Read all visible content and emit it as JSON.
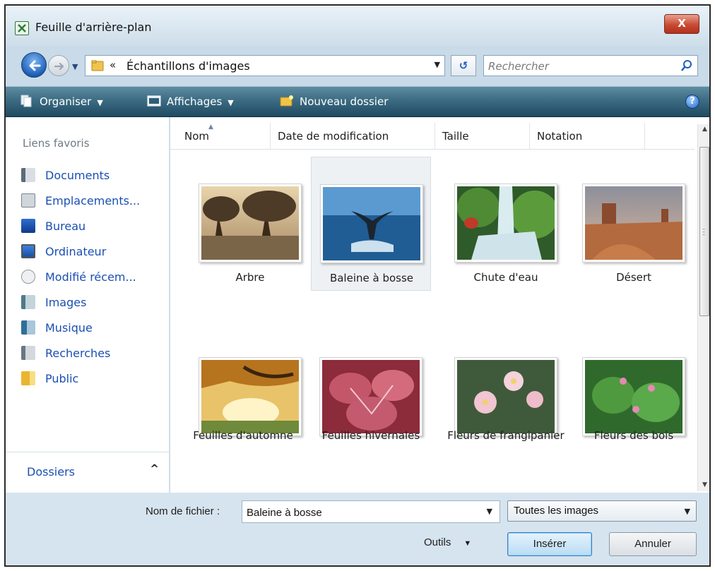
{
  "window": {
    "title": "Feuille d'arrière-plan",
    "close_label": "X"
  },
  "address": {
    "separator": "«",
    "path": "Échantillons d'images",
    "search_placeholder": "Rechercher",
    "refresh_label": "↺"
  },
  "toolbar": {
    "organize": "Organiser",
    "views": "Affichages",
    "new_folder": "Nouveau dossier",
    "help": "?"
  },
  "nav": {
    "title": "Liens favoris",
    "items": [
      {
        "label": "Documents",
        "icon": "documents-icon"
      },
      {
        "label": "Emplacements...",
        "icon": "network-places-icon"
      },
      {
        "label": "Bureau",
        "icon": "desktop-icon"
      },
      {
        "label": "Ordinateur",
        "icon": "computer-icon"
      },
      {
        "label": "Modifié récem...",
        "icon": "recent-icon"
      },
      {
        "label": "Images",
        "icon": "pictures-icon"
      },
      {
        "label": "Musique",
        "icon": "music-icon"
      },
      {
        "label": "Recherches",
        "icon": "searches-icon"
      },
      {
        "label": "Public",
        "icon": "public-folder-icon"
      }
    ],
    "folders_label": "Dossiers",
    "folders_toggle": "^"
  },
  "columns": [
    "Nom",
    "Date de modification",
    "Taille",
    "Notation"
  ],
  "files": [
    {
      "label": "Arbre",
      "selected": false
    },
    {
      "label": "Baleine à bosse",
      "selected": true
    },
    {
      "label": "Chute d'eau",
      "selected": false
    },
    {
      "label": "Désert",
      "selected": false
    },
    {
      "label": "Feuilles d'automne",
      "selected": false
    },
    {
      "label": "Feuilles hivernales",
      "selected": false
    },
    {
      "label": "Fleurs de frangipanier",
      "selected": false
    },
    {
      "label": "Fleurs des bois",
      "selected": false
    }
  ],
  "bottom": {
    "filename_label": "Nom de fichier :",
    "filename_value": "Baleine à bosse",
    "filetype": "Toutes les images",
    "tools": "Outils",
    "insert": "Insérer",
    "cancel": "Annuler"
  },
  "colors": {
    "accent": "#1a4fb3",
    "command_bar": "#3f6f86",
    "close": "#c84a33"
  }
}
